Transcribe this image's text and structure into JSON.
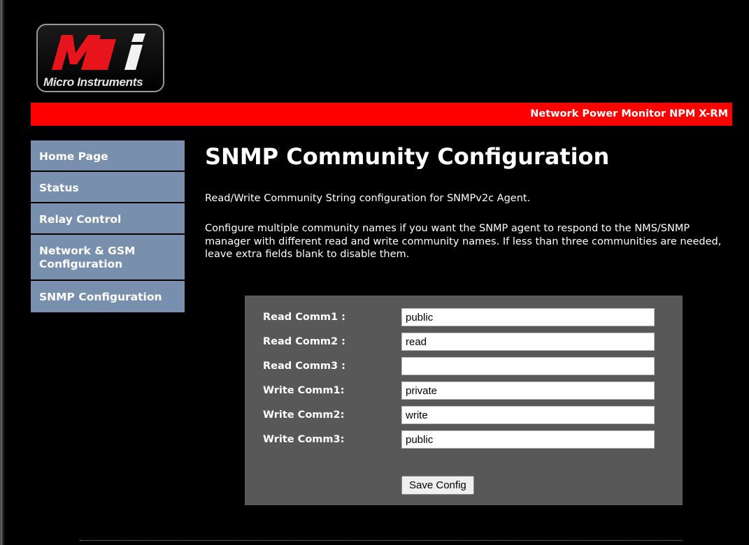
{
  "logo": {
    "mark": "Mi",
    "caption": "Micro Instruments"
  },
  "banner": {
    "title": "Network Power Monitor NPM X-RM"
  },
  "nav": {
    "items": [
      {
        "label": "Home Page"
      },
      {
        "label": "Status"
      },
      {
        "label": "Relay Control"
      },
      {
        "label": "Network & GSM Configuration"
      },
      {
        "label": "SNMP Configuration"
      }
    ]
  },
  "main": {
    "title": "SNMP Community Configuration",
    "intro": "Read/Write Community String configuration for SNMPv2c Agent.",
    "description": "Configure multiple community names if you want the SNMP agent to respond to the NMS/SNMP manager with different read and write community names. If less than three communities are needed, leave extra fields blank to disable them."
  },
  "form": {
    "fields": [
      {
        "label": "Read Comm1 :",
        "value": "public"
      },
      {
        "label": "Read Comm2 :",
        "value": "read"
      },
      {
        "label": "Read Comm3 :",
        "value": ""
      },
      {
        "label": "Write Comm1:",
        "value": "private"
      },
      {
        "label": "Write Comm2:",
        "value": "write"
      },
      {
        "label": "Write Comm3:",
        "value": "public"
      }
    ],
    "save_label": "Save Config"
  },
  "colors": {
    "banner": "#ff0000",
    "nav_bg": "#7890ae",
    "panel_bg": "#585858",
    "page_bg": "#000000",
    "logo_red": "#e8141c"
  }
}
